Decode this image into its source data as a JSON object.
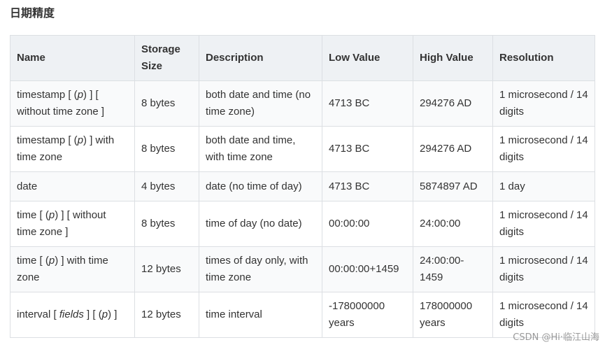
{
  "section": {
    "title": "日期精度"
  },
  "table": {
    "headers": {
      "name": "Name",
      "storage_size": "Storage Size",
      "description": "Description",
      "low_value": "Low Value",
      "high_value": "High Value",
      "resolution": "Resolution"
    },
    "rows": [
      {
        "name_parts": [
          "timestamp [ (",
          "p",
          ") ] [ without time zone ]"
        ],
        "storage_size": "8 bytes",
        "description": "both date and time (no time zone)",
        "low_value": "4713 BC",
        "high_value": "294276 AD",
        "resolution": "1 microsecond / 14 digits"
      },
      {
        "name_parts": [
          "timestamp [ (",
          "p",
          ") ] with time zone"
        ],
        "storage_size": "8 bytes",
        "description": "both date and time, with time zone",
        "low_value": "4713 BC",
        "high_value": "294276 AD",
        "resolution": "1 microsecond / 14 digits"
      },
      {
        "name_parts": [
          "date"
        ],
        "storage_size": "4 bytes",
        "description": "date (no time of day)",
        "low_value": "4713 BC",
        "high_value": "5874897 AD",
        "resolution": "1 day"
      },
      {
        "name_parts": [
          "time [ (",
          "p",
          ") ] [ without time zone ]"
        ],
        "storage_size": "8 bytes",
        "description": "time of day (no date)",
        "low_value": "00:00:00",
        "high_value": "24:00:00",
        "resolution": "1 microsecond / 14 digits"
      },
      {
        "name_parts": [
          "time [ (",
          "p",
          ") ] with time zone"
        ],
        "storage_size": "12 bytes",
        "description": "times of day only, with time zone",
        "low_value": "00:00:00+1459",
        "high_value": "24:00:00-1459",
        "resolution": "1 microsecond / 14 digits"
      },
      {
        "name_parts": [
          "interval [ ",
          "fields",
          " ] [ (",
          "p",
          ") ]"
        ],
        "storage_size": "12 bytes",
        "description": "time interval",
        "low_value": "-178000000 years",
        "high_value": "178000000 years",
        "resolution": "1 microsecond / 14 digits"
      }
    ]
  },
  "watermark": {
    "text": "CSDN @Hi·临江山海"
  }
}
